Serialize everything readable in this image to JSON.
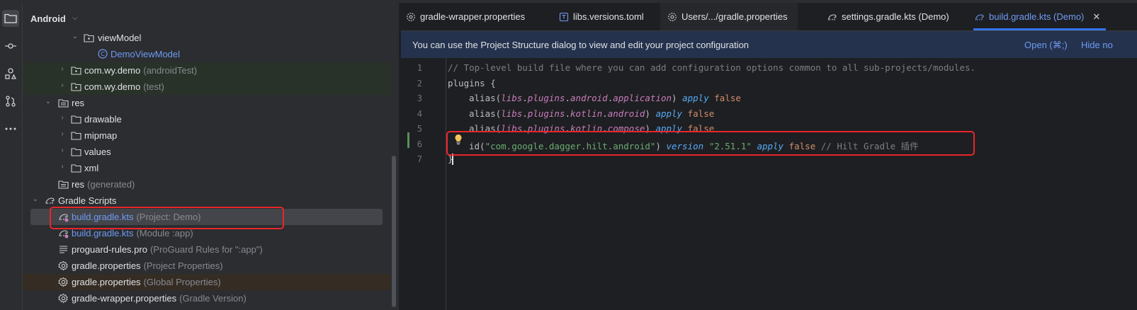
{
  "project_panel": {
    "title": "Android",
    "tree": [
      {
        "label": "viewModel",
        "hint": ""
      },
      {
        "label": "DemoViewModel",
        "hint": ""
      },
      {
        "label": "com.wy.demo",
        "hint": "(androidTest)"
      },
      {
        "label": "com.wy.demo",
        "hint": "(test)"
      },
      {
        "label": "res",
        "hint": ""
      },
      {
        "label": "drawable",
        "hint": ""
      },
      {
        "label": "mipmap",
        "hint": ""
      },
      {
        "label": "values",
        "hint": ""
      },
      {
        "label": "xml",
        "hint": ""
      },
      {
        "label": "res",
        "hint": "(generated)"
      },
      {
        "label": "Gradle Scripts",
        "hint": ""
      },
      {
        "label": "build.gradle.kts",
        "hint": "(Project: Demo)"
      },
      {
        "label": "build.gradle.kts",
        "hint": "(Module :app)"
      },
      {
        "label": "proguard-rules.pro",
        "hint": "(ProGuard Rules for \":app\")"
      },
      {
        "label": "gradle.properties",
        "hint": "(Project Properties)"
      },
      {
        "label": "gradle.properties",
        "hint": "(Global Properties)"
      },
      {
        "label": "gradle-wrapper.properties",
        "hint": "(Gradle Version)"
      }
    ]
  },
  "editor": {
    "tabs": [
      {
        "label": "gradle-wrapper.properties"
      },
      {
        "label": "libs.versions.toml"
      },
      {
        "label": "Users/.../gradle.properties"
      },
      {
        "label": "settings.gradle.kts (Demo)"
      },
      {
        "label": "build.gradle.kts (Demo)"
      }
    ],
    "banner": {
      "text": "You can use the Project Structure dialog to view and edit your project configuration",
      "open_label": "Open (⌘;)",
      "hide_label": "Hide no"
    },
    "line_numbers": [
      "1",
      "2",
      "3",
      "4",
      "5",
      "6",
      "7"
    ],
    "code": {
      "line1_comment": "// Top-level build file where you can add configuration options common to all sub-projects/modules.",
      "line2_plugins": "plugins",
      "line2_brace": " {",
      "alias_fn": "alias(",
      "libs": "libs",
      "plugins": "plugins",
      "android": "android",
      "application": "application",
      "kotlin": "kotlin",
      "compose": "compose",
      "dot": ".",
      "close_paren": ")",
      "apply": "apply",
      "false_kw": "false",
      "id_fn": "id(",
      "id_string": "\"com.google.dagger.hilt.android\"",
      "version_kw": "version",
      "version_string": "\"2.51.1\"",
      "line6_comment": "// Hilt Gradle 插件",
      "line7_brace": "}"
    }
  },
  "colors": {
    "accent": "#3574f0",
    "link": "#6f9bf3",
    "highlight_box": "#e8262b",
    "test_source_bg": "#293229",
    "global_props_bg": "#352c24"
  }
}
